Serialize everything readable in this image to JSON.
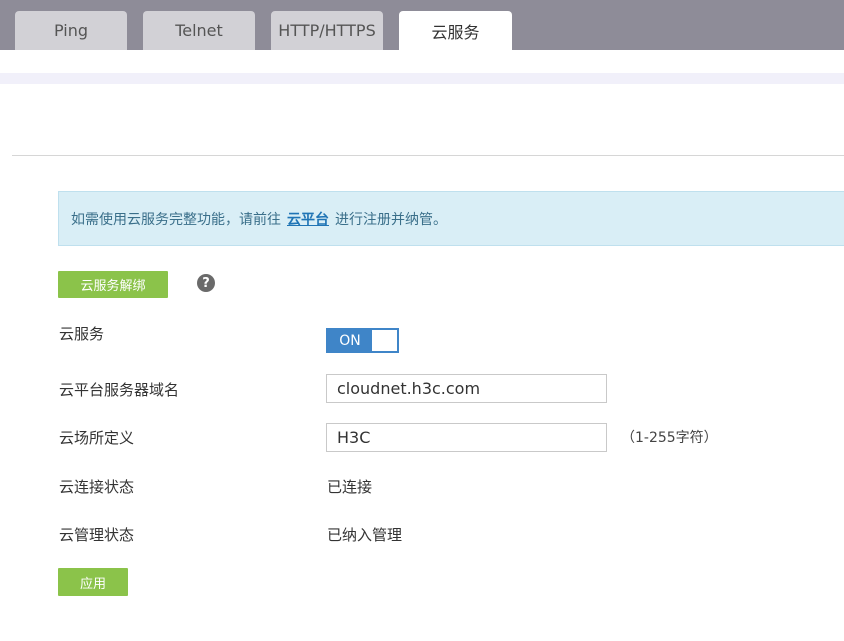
{
  "tabs": [
    {
      "label": "Ping"
    },
    {
      "label": "Telnet"
    },
    {
      "label": "HTTP/HTTPS"
    },
    {
      "label": "云服务"
    }
  ],
  "notice": {
    "prefix": "如需使用云服务完整功能，请前往",
    "link": "云平台",
    "suffix": "进行注册并纳管。"
  },
  "unbind_button": "云服务解绑",
  "help_icon": "?",
  "form": {
    "cloud_service": {
      "label": "云服务",
      "toggle": "ON"
    },
    "server_domain": {
      "label": "云平台服务器域名",
      "value": "cloudnet.h3c.com"
    },
    "site_name": {
      "label": "云场所定义",
      "value": "H3C",
      "hint": "（1-255字符）"
    },
    "connect_status": {
      "label": "云连接状态",
      "value": "已连接"
    },
    "manage_status": {
      "label": "云管理状态",
      "value": "已纳入管理"
    }
  },
  "apply_button": "应用",
  "colors": {
    "accent_green": "#8bc34a",
    "toggle_blue": "#3f85c8",
    "tabbar": "#8e8c98",
    "notice_bg": "#d9eef6"
  }
}
